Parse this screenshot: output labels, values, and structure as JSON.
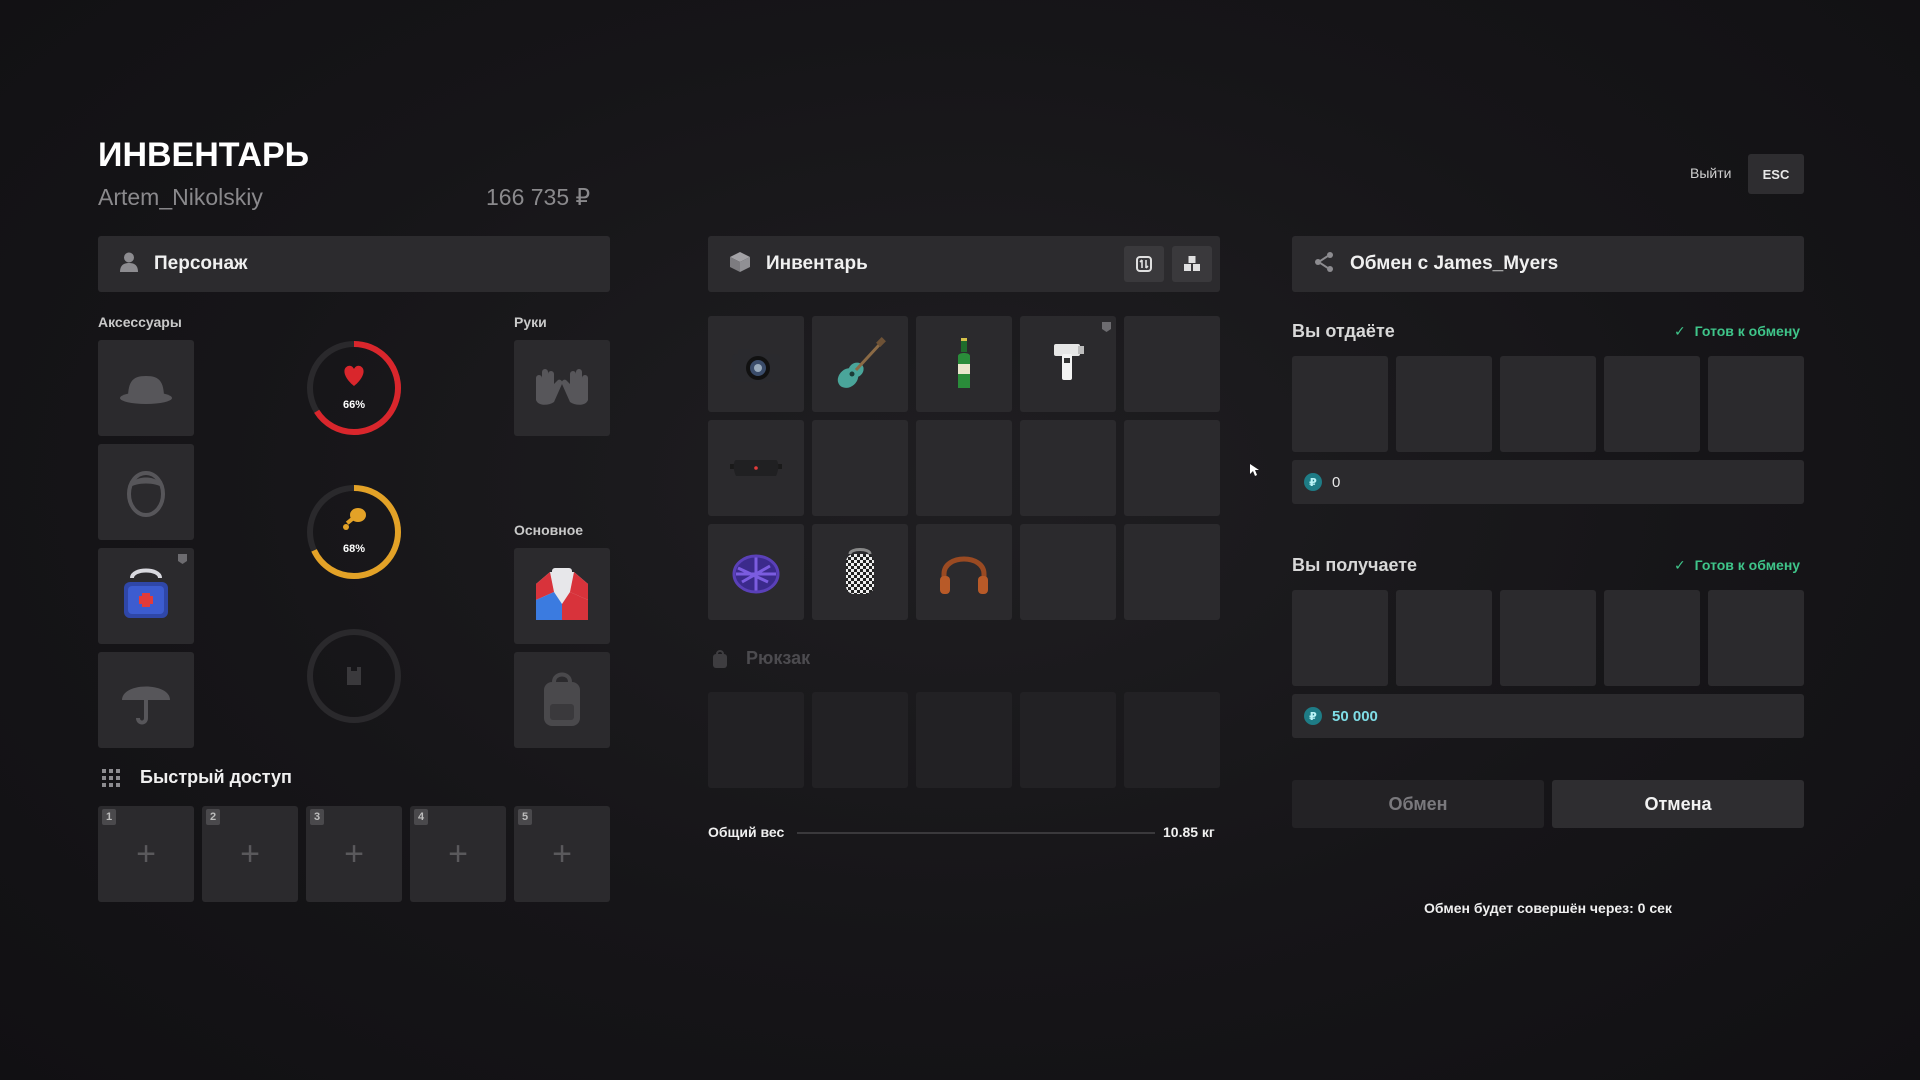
{
  "header": {
    "title": "ИНВЕНТАРЬ",
    "username": "Artem_Nikolskiy",
    "balance": "166 735 ₽",
    "exit_label": "Выйти",
    "esc_label": "ESC"
  },
  "character": {
    "title": "Персонаж",
    "accessories_label": "Аксессуары",
    "hands_label": "Руки",
    "main_label": "Основное",
    "health_percent": "66%",
    "hunger_percent": "68%",
    "health_fraction": 0.66,
    "hunger_fraction": 0.68,
    "colors": {
      "health": "#d9262c",
      "hunger": "#e3a227",
      "ring_track": "#2a292c"
    }
  },
  "quick_access": {
    "title": "Быстрый доступ",
    "slots": [
      "1",
      "2",
      "3",
      "4",
      "5"
    ]
  },
  "inventory": {
    "title": "Инвентарь",
    "items": [
      "camera-icon",
      "guitar-icon",
      "beer-bottle-icon",
      "radar-gun-icon",
      "",
      "belt-bag-icon",
      "",
      "",
      "",
      "",
      "purple-beret-icon",
      "checkered-bag-icon",
      "headphones-icon",
      "",
      ""
    ],
    "backpack_label": "Рюкзак",
    "weight_label": "Общий вес",
    "weight_value": "10.85 кг"
  },
  "trade": {
    "title": "Обмен с James_Myers",
    "give_label": "Вы отдаёте",
    "receive_label": "Вы получаете",
    "ready_label": "Готов к обмену",
    "give_money": "0",
    "receive_money": "50 000",
    "exchange_button": "Обмен",
    "cancel_button": "Отмена",
    "timer_text": "Обмен будет совершён через: 0 сек",
    "colors": {
      "ready": "#3fc58a",
      "currency": "#1e7c86",
      "receive_money": "#7fdde6"
    }
  }
}
